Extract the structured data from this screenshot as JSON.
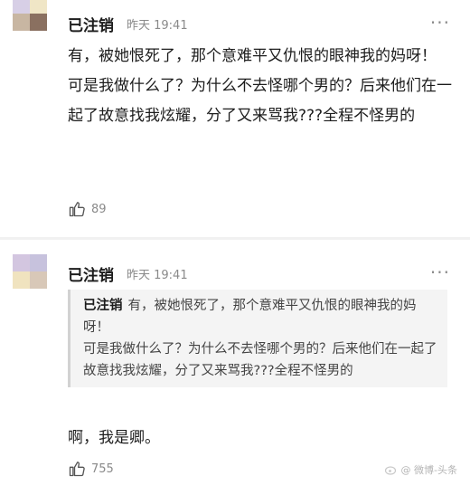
{
  "comments": [
    {
      "username": "已注销",
      "time": "昨天 19:41",
      "body": "有，被她恨死了，那个意难平又仇恨的眼神我的妈呀！\n可是我做什么了？为什么不去怪哪个男的？后来他们在一起了故意找我炫耀，分了又来骂我???全程不怪男的",
      "likes": "89",
      "avatar_colors": [
        "#d7cfe6",
        "#f0e6c6",
        "#c8b6a2",
        "#8a7060"
      ]
    },
    {
      "username": "已注销",
      "time": "昨天 19:41",
      "quote_user": "已注销",
      "quote_text": "有，被她恨死了，那个意难平又仇恨的眼神我的妈呀！\n可是我做什么了？为什么不去怪哪个男的？后来他们在一起了故意找我炫耀，分了又来骂我???全程不怪男的",
      "body": "啊，我是卿。",
      "likes": "755",
      "avatar_colors": [
        "#d3c6e0",
        "#c7c2dd",
        "#f0e3bf",
        "#d8c8b8"
      ]
    }
  ],
  "more_label": "···",
  "watermark": "@ 微博-头条"
}
